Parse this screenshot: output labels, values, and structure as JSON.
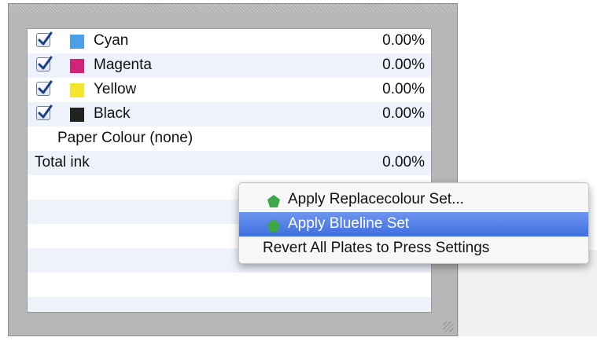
{
  "inks": [
    {
      "name": "Cyan",
      "value": "0.00%",
      "checked": true,
      "color": "#4a9fe6"
    },
    {
      "name": "Magenta",
      "value": "0.00%",
      "checked": true,
      "color": "#d1237a"
    },
    {
      "name": "Yellow",
      "value": "0.00%",
      "checked": true,
      "color": "#f5e52c"
    },
    {
      "name": "Black",
      "value": "0.00%",
      "checked": true,
      "color": "#222222"
    }
  ],
  "paper": {
    "label": "Paper Colour (none)"
  },
  "total": {
    "label": "Total ink",
    "value": "0.00%"
  },
  "context_menu": {
    "items": [
      {
        "label": "Apply Replacecolour Set...",
        "icon": "green-pentagon-icon",
        "selected": false
      },
      {
        "label": "Apply Blueline Set",
        "icon": "green-pentagon-icon",
        "selected": true
      },
      {
        "label": "Revert All Plates to Press Settings",
        "icon": "",
        "selected": false
      }
    ]
  },
  "colors": {
    "highlight": "#3f6fe0",
    "pentagon": "#3ca84a",
    "check": "#1d3f8a"
  }
}
